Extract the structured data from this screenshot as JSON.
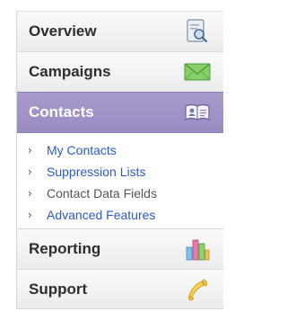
{
  "nav": {
    "items": [
      {
        "label": "Overview",
        "icon": "magnifier-icon"
      },
      {
        "label": "Campaigns",
        "icon": "envelope-icon"
      },
      {
        "label": "Contacts",
        "icon": "address-book-icon",
        "active": true
      },
      {
        "label": "Reporting",
        "icon": "bar-chart-icon"
      },
      {
        "label": "Support",
        "icon": "telephone-icon"
      }
    ],
    "contacts_sub": [
      {
        "label": "My Contacts"
      },
      {
        "label": "Suppression Lists"
      },
      {
        "label": "Contact Data Fields"
      },
      {
        "label": "Advanced Features"
      }
    ]
  },
  "colors": {
    "active_bg": "#a095c8",
    "link": "#2a5bc9",
    "muted": "#555555",
    "label": "#2e2e2e"
  }
}
